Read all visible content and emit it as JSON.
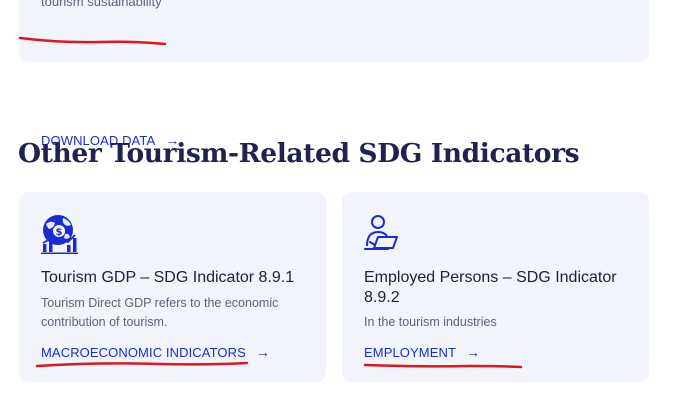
{
  "top_card": {
    "description": "tourism sustainability",
    "link_label": "DOWNLOAD DATA",
    "link_arrow": "→"
  },
  "section": {
    "title": "Other Tourism-Related SDG Indicators"
  },
  "cards": [
    {
      "icon": "globe-money-chart-icon",
      "title": "Tourism GDP – SDG Indicator 8.9.1",
      "description": "Tourism Direct GDP refers to the economic contribution of tourism.",
      "link_label": "MACROECONOMIC INDICATORS",
      "link_arrow": "→"
    },
    {
      "icon": "person-laptop-icon",
      "title": "Employed Persons – SDG Indicator 8.9.2",
      "description": "In the tourism industries",
      "link_label": "EMPLOYMENT",
      "link_arrow": "→"
    }
  ],
  "colors": {
    "accent_link": "#1b2bd2",
    "heading": "#1e2350",
    "card_bg": "#f1f4fb",
    "annotation_red": "#e0141e"
  }
}
